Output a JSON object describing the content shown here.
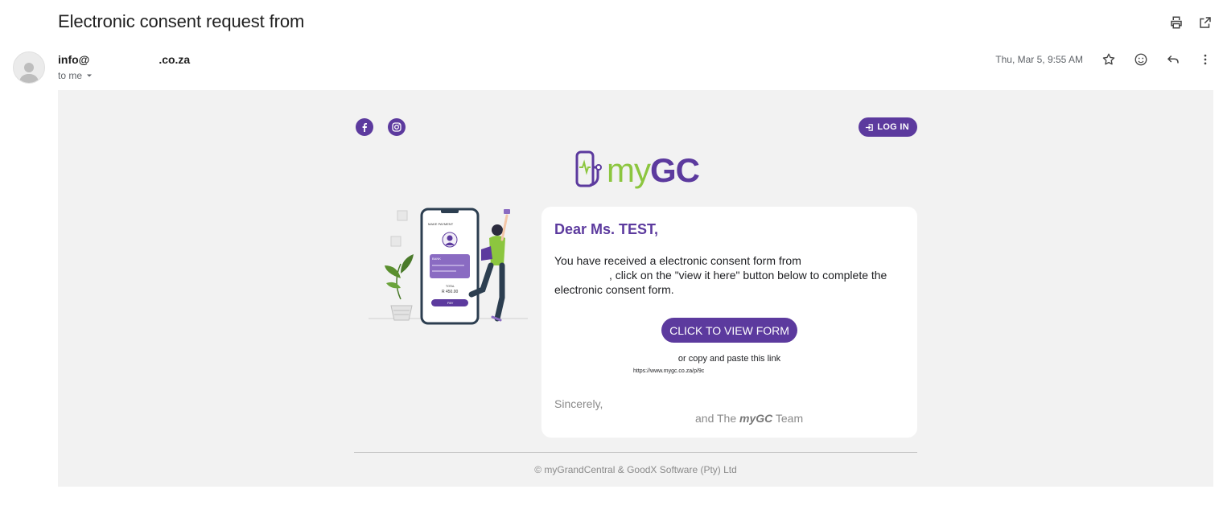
{
  "email": {
    "subject": "Electronic consent request from",
    "sender_prefix": "info@",
    "sender_domain": ".co.za",
    "recipient": "to me",
    "date": "Thu, Mar 5, 9:55 AM"
  },
  "newsletter": {
    "login_label": "LOG IN",
    "logo_my": "my",
    "logo_gc": "GC",
    "greeting": "Dear Ms. TEST,",
    "para_line1": "You have received a electronic consent form from",
    "para_line2": ", click on the \"view it here\" button below to complete the",
    "para_line3": "electronic consent form.",
    "button_label": "CLICK TO VIEW FORM",
    "copy_text": "or copy and paste this link",
    "link": "https://www.mygc.co.za/p/9c",
    "sincerely": "Sincerely,",
    "team_prefix": "and The",
    "team_brand": "myGC",
    "team_suffix": "Team",
    "footer": "© myGrandCentral & GoodX Software (Pty) Ltd"
  },
  "illustration": {
    "phone_title": "MAKE PAYMENT",
    "card_bank": "BANK",
    "total_label": "TOTAL",
    "total_value": "R 450.00",
    "pay_label": "PAY"
  },
  "colors": {
    "brand_purple": "#5c3a9e",
    "brand_green": "#8cc63f"
  },
  "icons": [
    "print-icon",
    "open-in-new-icon",
    "star-icon",
    "emoji-icon",
    "reply-icon",
    "more-vert-icon",
    "facebook-icon",
    "instagram-icon",
    "login-icon"
  ]
}
